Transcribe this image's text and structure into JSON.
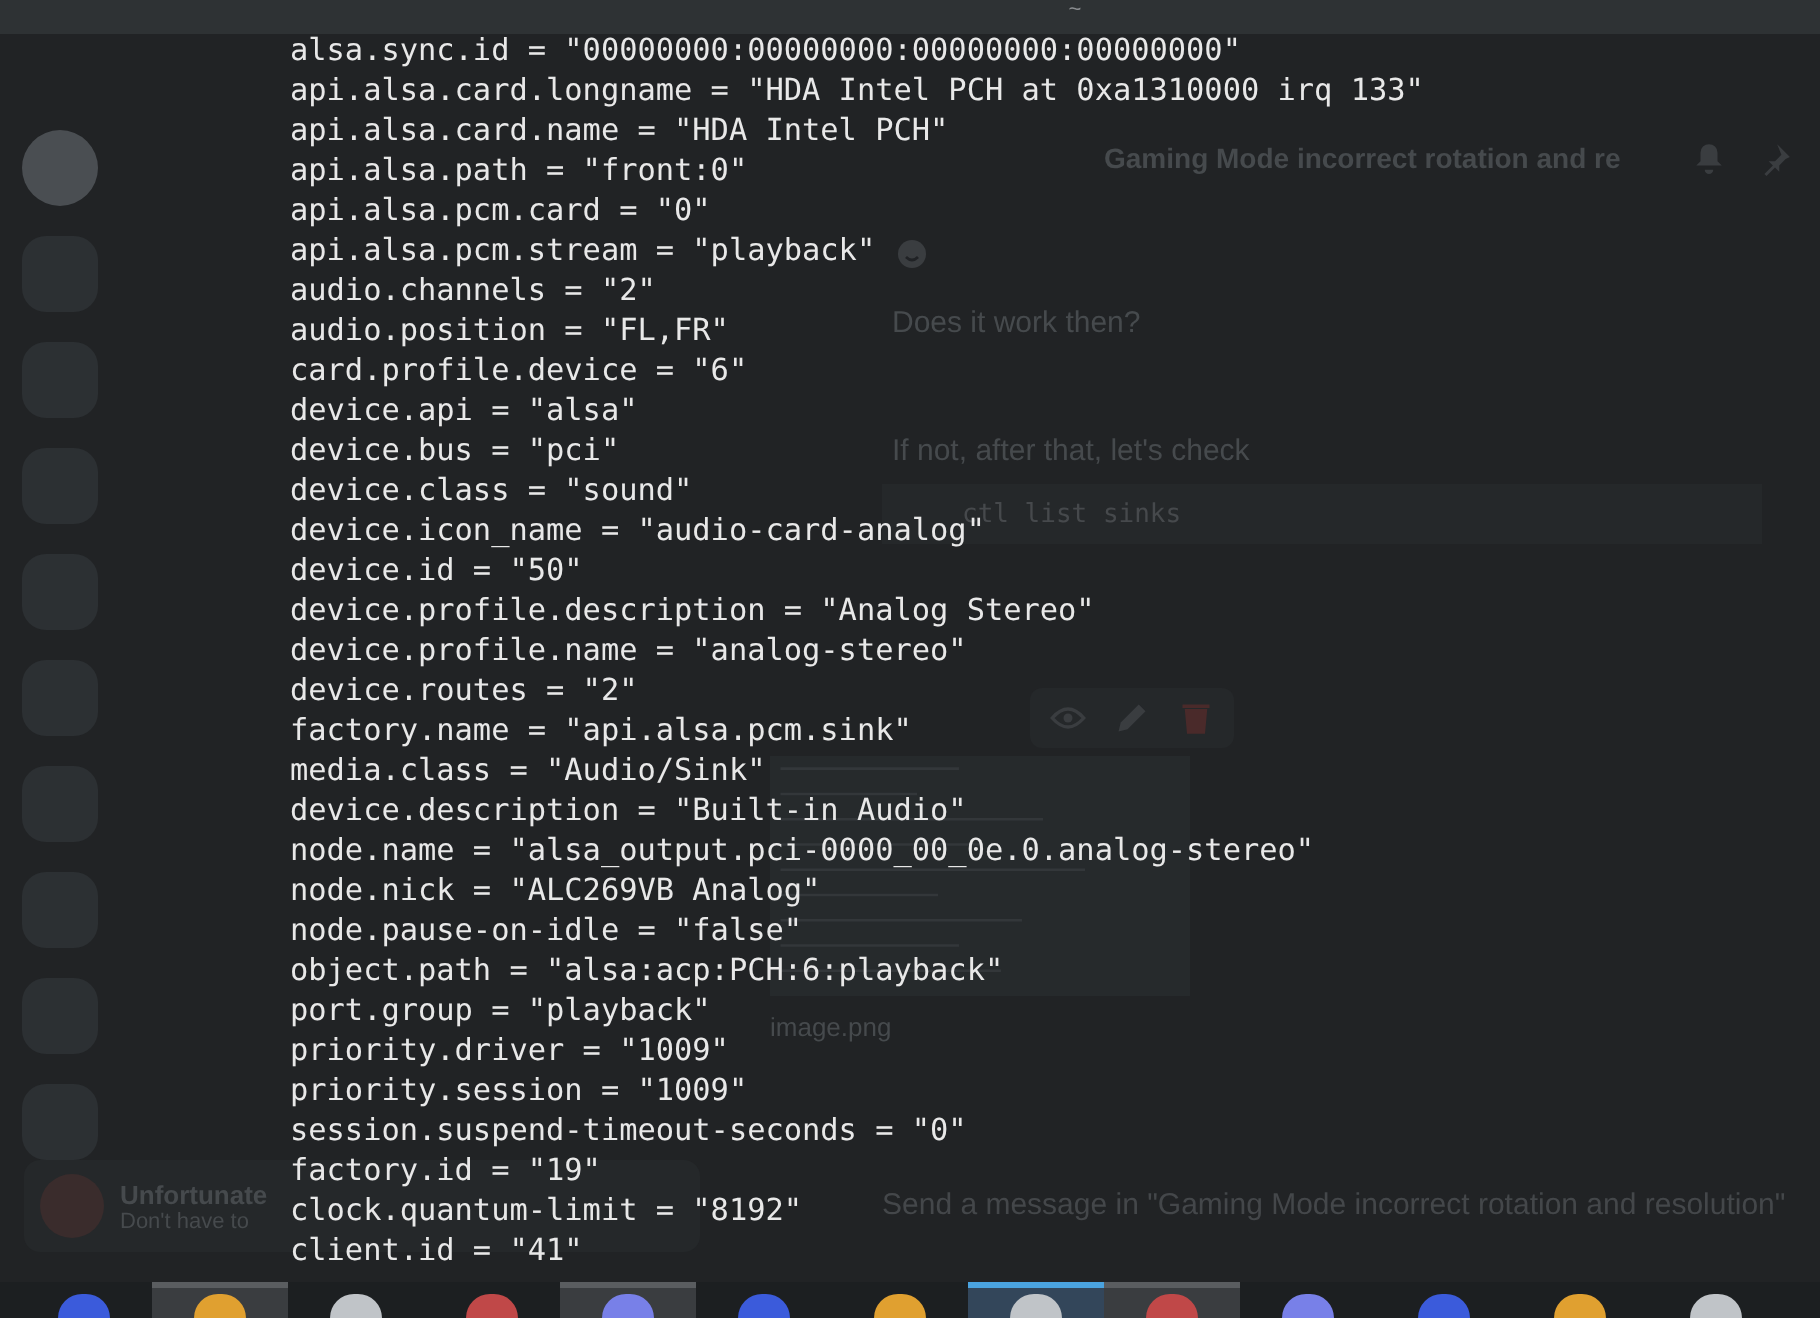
{
  "titlebar": {
    "title": "~"
  },
  "background_window": {
    "user": {
      "name": "Unfortunate",
      "status": "Don't have to"
    },
    "channel": {
      "thread": "Gaming Mode incorrect rotation and re"
    },
    "messages": [
      {
        "kind": "text",
        "text": "Does it work then?"
      },
      {
        "kind": "text",
        "text": "If not, after that, let's check"
      },
      {
        "kind": "code",
        "text": "ctl list sinks"
      }
    ],
    "attachment": {
      "name": "image.png"
    },
    "composer": {
      "placeholder": "Send a message in \"Gaming Mode incorrect rotation and resolution\""
    }
  },
  "terminal": {
    "lines": [
      "alsa.sync.id = \"00000000:00000000:00000000:00000000\"",
      "api.alsa.card.longname = \"HDA Intel PCH at 0xa1310000 irq 133\"",
      "api.alsa.card.name = \"HDA Intel PCH\"",
      "api.alsa.path = \"front:0\"",
      "api.alsa.pcm.card = \"0\"",
      "api.alsa.pcm.stream = \"playback\"",
      "audio.channels = \"2\"",
      "audio.position = \"FL,FR\"",
      "card.profile.device = \"6\"",
      "device.api = \"alsa\"",
      "device.bus = \"pci\"",
      "device.class = \"sound\"",
      "device.icon_name = \"audio-card-analog\"",
      "device.id = \"50\"",
      "device.profile.description = \"Analog Stereo\"",
      "device.profile.name = \"analog-stereo\"",
      "device.routes = \"2\"",
      "factory.name = \"api.alsa.pcm.sink\"",
      "media.class = \"Audio/Sink\"",
      "device.description = \"Built-in Audio\"",
      "node.name = \"alsa_output.pci-0000_00_0e.0.analog-stereo\"",
      "node.nick = \"ALC269VB Analog\"",
      "node.pause-on-idle = \"false\"",
      "object.path = \"alsa:acp:PCH:6:playback\"",
      "port.group = \"playback\"",
      "priority.driver = \"1009\"",
      "priority.session = \"1009\"",
      "session.suspend-timeout-seconds = \"0\"",
      "factory.id = \"19\"",
      "clock.quantum-limit = \"8192\"",
      "client.id = \"41\""
    ]
  }
}
